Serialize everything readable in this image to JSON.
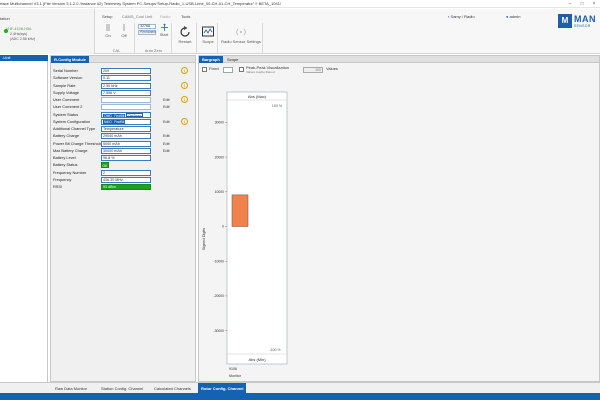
{
  "window": {
    "title": "rface Multichannel V3.1 (File Version 3.1.2.0 /Instance #2) Telemetry System PC-Setups\"Setup-Radio_1-USB-Lime_00-CH-01-CH_Temperatur\" !! BETA_1041!"
  },
  "ribbon": {
    "tabs": [
      "Setup",
      "CAMS_Cool Unit",
      "Radio",
      "Tools"
    ],
    "station": {
      "label": "tation",
      "line1": "VHF-4124LH5A",
      "line2": "2.4Hz(sys)",
      "line3": "(ADC 2.56 kHz)"
    },
    "cal_group": {
      "on_label": "On",
      "off_label": "Off",
      "group_label": "CAL"
    },
    "autozero_group": {
      "value": "32768",
      "mode": "Permanent",
      "start_label": "Start",
      "group_label": "Auto Zero"
    },
    "restart_label": "Restart",
    "scope_label": "Scope",
    "radio_settings_label": "Radio Sensor Settings",
    "user_1": "Samy / Radio",
    "user_2": "admin",
    "brand_mark": "M",
    "brand_word": "MAN",
    "brand_sub": "SENSOR"
  },
  "sidebar": {
    "selected_item": "-Unit"
  },
  "config_panel": {
    "header": "R-Config Module",
    "rows": [
      {
        "key": "Serial Number",
        "value": "209",
        "info": true
      },
      {
        "key": "Software Version",
        "value": "0.11"
      },
      {
        "key": "Sample Rate",
        "value": "2.50 kHz",
        "info": true
      },
      {
        "key": "Supply Voltage",
        "value": "7.556 V"
      },
      {
        "key": "User Comment",
        "value": "",
        "edit": "Edit",
        "info": true
      },
      {
        "key": "User Comment 2",
        "value": "",
        "edit": "Edit"
      },
      {
        "key": "System Status",
        "chips": [
          "OMG",
          "FewBit",
          "CtrlStrap"
        ]
      },
      {
        "key": "System Configuration",
        "chips": [
          "NdIO",
          "FewBit"
        ],
        "edit": "Edit",
        "info": true
      },
      {
        "key": "Additional Channel Type",
        "value": "Temperature"
      },
      {
        "key": "Battery Charge",
        "value": "29040 mAh",
        "edit": "Edit"
      },
      {
        "key": "Power Bit Charge Threshold",
        "value": "5000 mAh",
        "edit": "Edit"
      },
      {
        "key": "Max Battery Charge",
        "value": "30000 mAh",
        "edit": "Edit"
      },
      {
        "key": "Battery Level",
        "value": "96.8 %"
      },
      {
        "key": "Battery Status",
        "value": "OK"
      },
      {
        "key": "Frequency Number",
        "value": "2"
      },
      {
        "key": "Frequency",
        "value": "436.30 MHz"
      },
      {
        "key": "RSSI",
        "value": "93 dBm"
      }
    ]
  },
  "bargraph_panel": {
    "tabs": [
      "Bargraph",
      "Scope"
    ],
    "fixed_label": "Fixed",
    "peak_label": "Peak-Peak Visualization",
    "peak_sub": "Values maybe filtered",
    "values_select": "100",
    "values_label": "Values",
    "column_header": "Abs (Max)",
    "column_footer": "Abs (Min)",
    "top_percent": "100 %",
    "bottom_percent": "-100 %",
    "under_1": "9106",
    "under_2": "Monitor"
  },
  "chart_data": {
    "type": "bar",
    "categories": [
      "Channel"
    ],
    "values": [
      9106
    ],
    "ylabel": "Signed Digits",
    "ylim": [
      -35000,
      35000
    ],
    "yticks": [
      30000,
      20000,
      10000,
      0,
      -10000,
      -20000,
      -30000
    ],
    "ytick_labels": [
      "30000",
      "20000",
      "10000",
      "0",
      "-10000",
      "-20000",
      "-30000"
    ],
    "bar_color": "#f0814b"
  },
  "bottom_tabs": [
    "Raw Data Monitor",
    "Station Config. Channel",
    "Calculated Channels",
    "Rotor Config. Channel"
  ],
  "active_bottom_tab": 3,
  "colors": {
    "accent": "#1463b3",
    "ok_green": "#19a319",
    "bar": "#f0814b"
  }
}
